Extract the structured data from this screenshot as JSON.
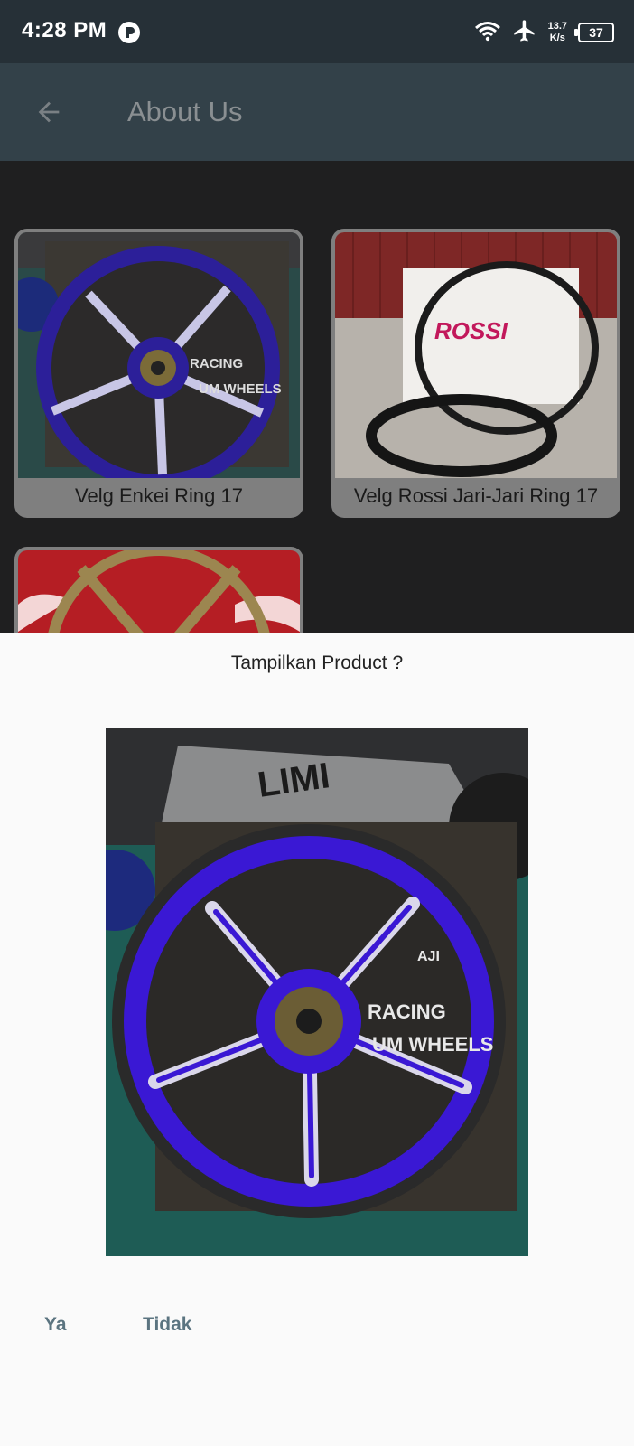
{
  "status_bar": {
    "time": "4:28 PM",
    "net_speed_value": "13.7",
    "net_speed_unit": "K/s",
    "battery": "37",
    "icons": [
      "app-notification-icon",
      "wifi-icon",
      "airplane-mode-icon",
      "battery-icon"
    ]
  },
  "app_bar": {
    "title": "About Us",
    "back_icon": "arrow-left-icon"
  },
  "products": [
    {
      "label": "Velg Enkei Ring 17",
      "image": "blue-alloy-wheel"
    },
    {
      "label": "Velg Rossi Jari-Jari Ring 17",
      "image": "black-spoke-rims"
    },
    {
      "label": "",
      "image": "gold-wheel-partial"
    }
  ],
  "dialog": {
    "title": "Tampilkan Product ?",
    "image": "blue-alloy-wheel-large",
    "actions": {
      "yes": "Ya",
      "no": "Tidak"
    }
  },
  "colors": {
    "status_bar": "#263037",
    "app_bar": "#334149",
    "background": "#1f1f20",
    "dialog_background": "#fafafa",
    "action_text": "#5b7480",
    "wheel_blue": "#3d1fd6"
  }
}
